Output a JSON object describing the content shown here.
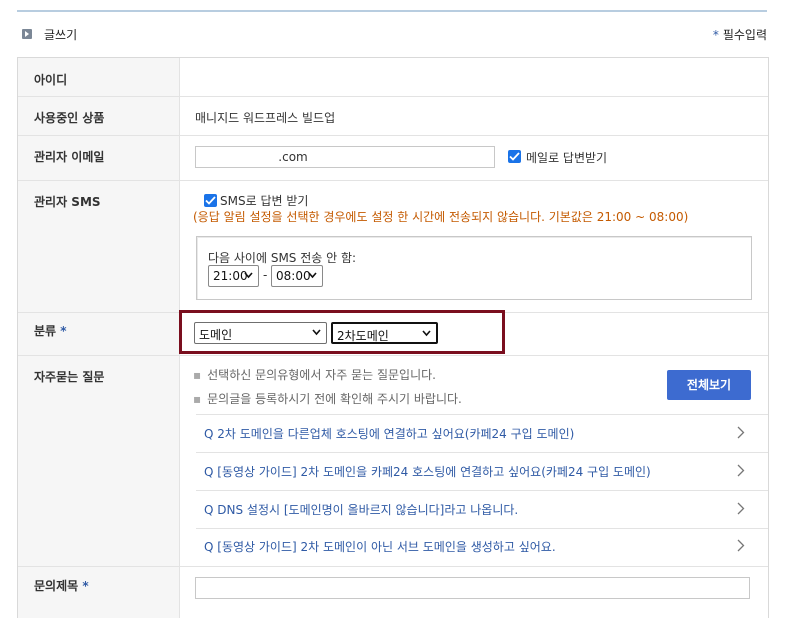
{
  "header": {
    "title": "글쓰기",
    "required_star": "*",
    "required_note": "필수입력"
  },
  "form": {
    "id_label": "아이디",
    "product_label": "사용중인 상품",
    "product_value": "매니지드 워드프레스 빌드업",
    "email_label": "관리자 이메일",
    "email_value": "                    .com",
    "email_reply_label": "메일로 답변받기",
    "sms_label": "관리자 SMS",
    "sms_reply_label": "SMS로 답변 받기",
    "sms_notice": "(응답 알림 설정을 선택한 경우에도 설정 한 시간에 전송되지 않습니다. 기본값은 21:00 ~ 08:00)",
    "sms_block_label": "다음 사이에 SMS 전송 안 함:",
    "sms_from": "21:00",
    "sms_separator": "-",
    "sms_to": "08:00",
    "category_label": "분류",
    "category_star": "*",
    "category_primary": "도메인",
    "category_secondary": "2차도메인",
    "faq_label": "자주묻는 질문",
    "faq_hint_1": "선택하신 문의유형에서 자주 묻는 질문입니다.",
    "faq_hint_2": "문의글을 등록하시기 전에 확인해 주시기 바랍니다.",
    "faq_view_all": "전체보기",
    "faq_items": [
      "Q 2차 도메인을 다른업체 호스팅에 연결하고 싶어요(카페24 구입 도메인)",
      "Q [동영상 가이드] 2차 도메인을 카페24 호스팅에 연결하고 싶어요(카페24 구입 도메인)",
      "Q DNS 설정시 [도메인명이 올바르지 않습니다]라고 나옵니다.",
      "Q [동영상 가이드] 2차 도메인이 아닌 서브 도메인을 생성하고 싶어요."
    ],
    "subject_label": "문의제목",
    "subject_star": "*",
    "subject_value": ""
  },
  "colors": {
    "accent": "#2f5aa5",
    "button": "#3d6bd0",
    "highlight": "#7a0e1e",
    "notice": "#c45a00"
  }
}
